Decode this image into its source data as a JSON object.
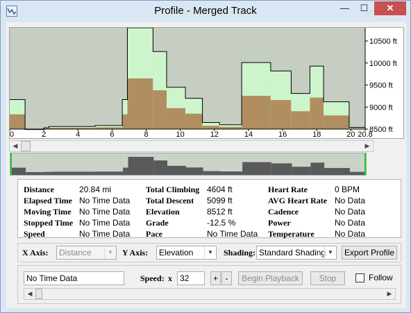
{
  "window": {
    "title": "Profile - Merged Track",
    "minimize": "—",
    "maximize": "☐",
    "close": "✕"
  },
  "chart_data": {
    "type": "area",
    "title": "",
    "xlabel": "",
    "ylabel": "",
    "xlim": [
      0,
      20.84
    ],
    "ylim": [
      8500,
      10800
    ],
    "x_ticks": [
      "0",
      "2",
      "4",
      "6",
      "8",
      "10",
      "12",
      "14",
      "16",
      "18",
      "20",
      "20.8"
    ],
    "x_tick_values": [
      0,
      2,
      4,
      6,
      8,
      10,
      12,
      14,
      16,
      18,
      20,
      20.84
    ],
    "y_ticks": [
      "8500 ft",
      "9000 ft",
      "9500 ft",
      "10000 ft",
      "10500 ft"
    ],
    "y_tick_values": [
      8500,
      9000,
      9500,
      10000,
      10500
    ],
    "grid": false,
    "series": [
      {
        "values": [
          {
            "x0": 0,
            "x1": 0.9,
            "y": 9170
          },
          {
            "x0": 0.9,
            "x1": 2.0,
            "y": 8490
          },
          {
            "x0": 2.0,
            "x1": 2.3,
            "y": 8530
          },
          {
            "x0": 2.3,
            "x1": 5.0,
            "y": 8560
          },
          {
            "x0": 5.0,
            "x1": 6.6,
            "y": 8580
          },
          {
            "x0": 6.6,
            "x1": 6.9,
            "y": 9170
          },
          {
            "x0": 6.9,
            "x1": 8.4,
            "y": 10800
          },
          {
            "x0": 8.4,
            "x1": 9.2,
            "y": 10260
          },
          {
            "x0": 9.2,
            "x1": 10.3,
            "y": 9450
          },
          {
            "x0": 10.3,
            "x1": 11.3,
            "y": 9200
          },
          {
            "x0": 11.3,
            "x1": 12.3,
            "y": 8650
          },
          {
            "x0": 12.3,
            "x1": 13.6,
            "y": 8600
          },
          {
            "x0": 13.6,
            "x1": 15.3,
            "y": 10010
          },
          {
            "x0": 15.3,
            "x1": 16.5,
            "y": 9820
          },
          {
            "x0": 16.5,
            "x1": 17.6,
            "y": 9310
          },
          {
            "x0": 17.6,
            "x1": 18.4,
            "y": 9930
          },
          {
            "x0": 18.4,
            "x1": 19.9,
            "y": 9120
          },
          {
            "x0": 19.9,
            "x1": 20.84,
            "y": 8540
          }
        ]
      }
    ],
    "shading_band": 0.5
  },
  "colors": {
    "plot_bg": "#c6cec3",
    "fill_light": "#ccf5cc",
    "fill_dark": "#b18e60",
    "outline": "#000000",
    "overview_fill": "#5a5a5a",
    "overview_bg": "#c9d3c7",
    "overview_marker": "#22cc22"
  },
  "stats": {
    "distance": {
      "label": "Distance",
      "value": "20.84 mi"
    },
    "elapsed": {
      "label": "Elapsed Time",
      "value": "No Time Data"
    },
    "moving": {
      "label": "Moving Time",
      "value": "No Time Data"
    },
    "stopped": {
      "label": "Stopped Time",
      "value": "No Time Data"
    },
    "speed": {
      "label": "Speed",
      "value": "No Time Data"
    },
    "climbing": {
      "label": "Total Climbing",
      "value": "4604 ft"
    },
    "descent": {
      "label": "Total Descent",
      "value": "5099 ft"
    },
    "elevation": {
      "label": "Elevation",
      "value": "8512 ft"
    },
    "grade": {
      "label": "Grade",
      "value": "-12.5 %"
    },
    "pace": {
      "label": "Pace",
      "value": "No Time Data"
    },
    "heart": {
      "label": "Heart Rate",
      "value": "0 BPM"
    },
    "avg_heart": {
      "label": "AVG Heart Rate",
      "value": "No Data"
    },
    "cadence": {
      "label": "Cadence",
      "value": "No Data"
    },
    "power": {
      "label": "Power",
      "value": "No Data"
    },
    "temperature": {
      "label": "Temperature",
      "value": "No Data"
    }
  },
  "controls": {
    "x_axis_label": "X Axis:",
    "x_axis_value": "Distance",
    "y_axis_label": "Y Axis:",
    "y_axis_value": "Elevation",
    "shading_label": "Shading:",
    "shading_value": "Standard Shading",
    "export_label": "Export Profile"
  },
  "playback": {
    "status_text": "No Time Data",
    "speed_label": "Speed:",
    "speed_x": "x",
    "speed_value": "32",
    "plus": "+",
    "minus": "-",
    "begin_label": "Begin Playback",
    "stop_label": "Stop",
    "follow_label": "Follow"
  },
  "overview_marker_fraction": 1.0,
  "scroll_thumb_fraction": 0.0
}
